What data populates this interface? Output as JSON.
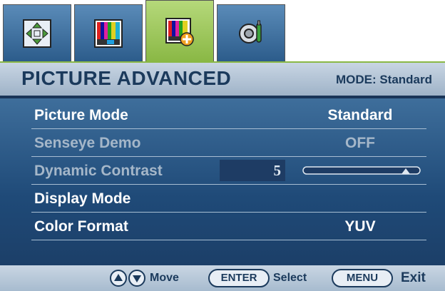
{
  "tabs": [
    {
      "icon": "move-arrows-icon",
      "active": false
    },
    {
      "icon": "color-bars-icon",
      "active": false
    },
    {
      "icon": "color-bars-plus-icon",
      "active": true
    },
    {
      "icon": "gear-settings-icon",
      "active": false
    }
  ],
  "header": {
    "title": "PICTURE ADVANCED",
    "mode": "MODE: Standard"
  },
  "menu": [
    {
      "label": "Picture Mode",
      "value": "Standard",
      "enabled": true
    },
    {
      "label": "Senseye Demo",
      "value": "OFF",
      "enabled": false
    },
    {
      "label": "Dynamic Contrast",
      "value": "5",
      "enabled": false,
      "level": 0.9
    },
    {
      "label": "Display Mode",
      "value": "",
      "enabled": true
    },
    {
      "label": "Color Format",
      "value": "YUV",
      "enabled": true
    }
  ],
  "footer": {
    "move": "Move",
    "enter": "ENTER",
    "select": "Select",
    "menu": "MENU",
    "exit": "Exit"
  },
  "colors": {
    "active_tab": "#8ab845",
    "panel": "#1f4a78",
    "header": "#c8d5e3",
    "text_dark": "#1b3a5c"
  }
}
